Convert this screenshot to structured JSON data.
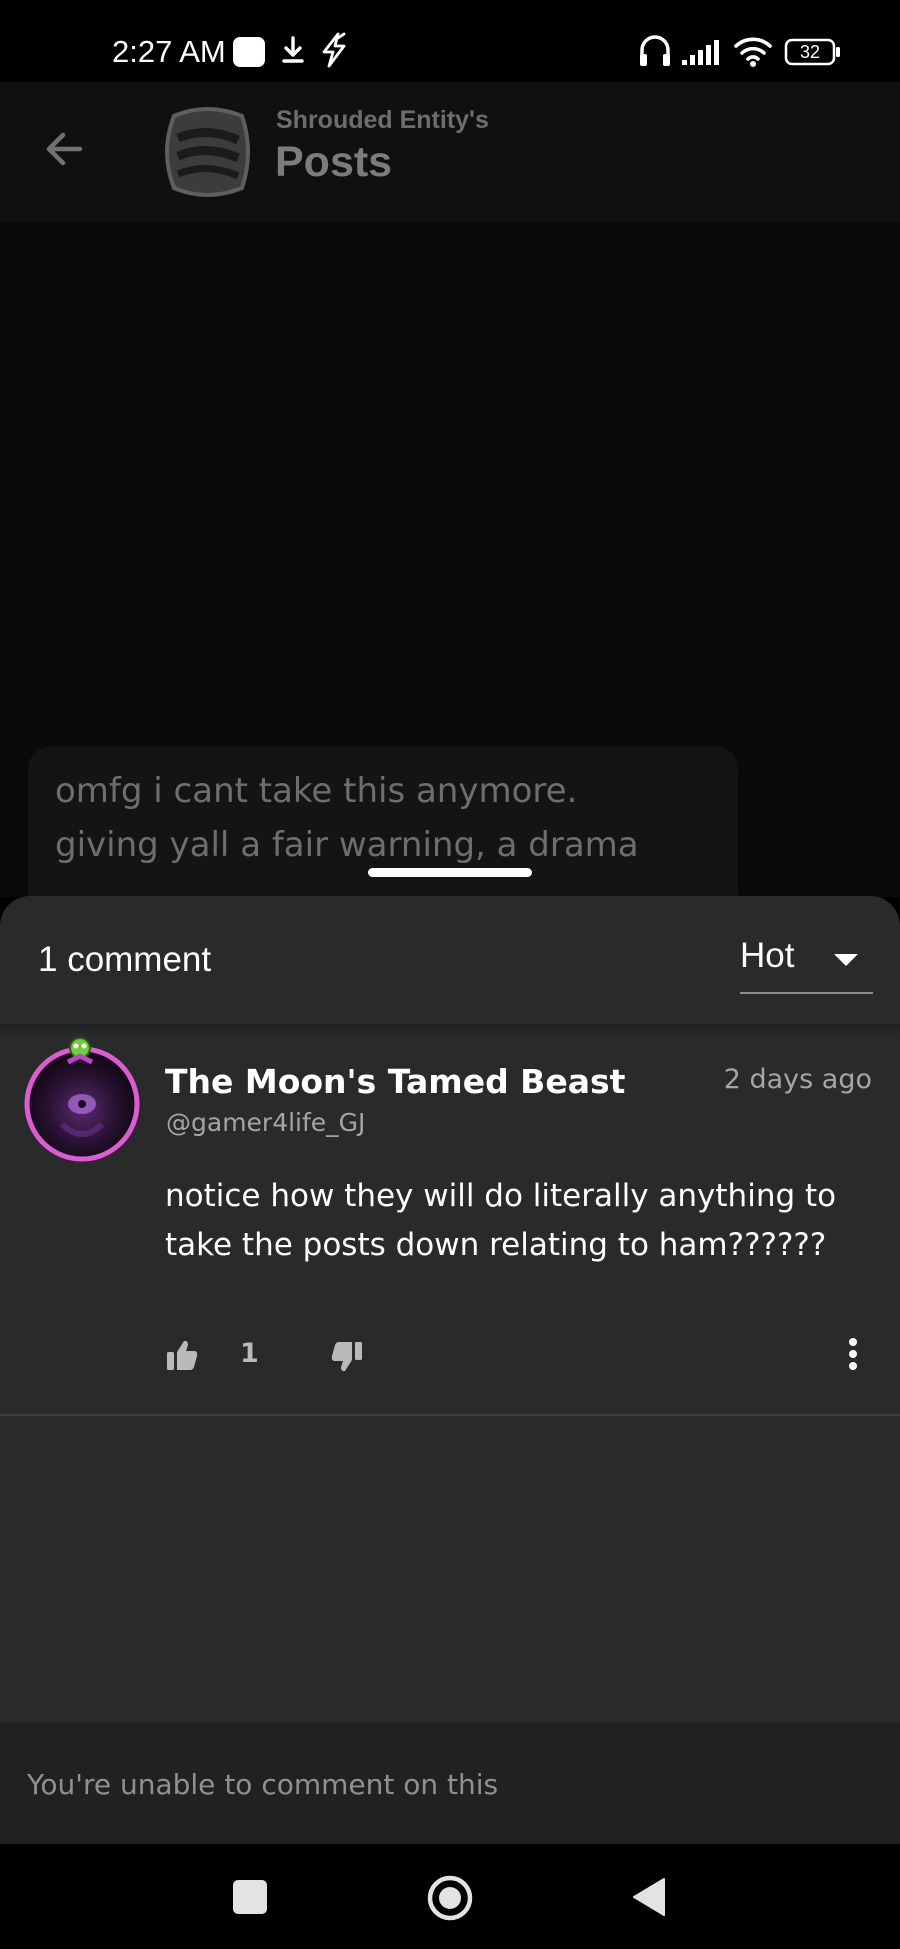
{
  "status_bar": {
    "time": "2:27 AM",
    "battery": "32",
    "icons": [
      "app-notification-icon",
      "download-icon",
      "flash-icon",
      "headphones-icon",
      "signal-icon",
      "wifi-icon",
      "battery-icon"
    ]
  },
  "header": {
    "subtitle": "Shrouded Entity's",
    "title": "Posts"
  },
  "post": {
    "line1": "omfg i cant take this anymore.",
    "line2": "giving yall a fair warning, a drama"
  },
  "comments_sheet": {
    "count_label": "1 comment",
    "sort": {
      "selected": "Hot"
    },
    "comments": [
      {
        "author": "The Moon's Tamed Beast",
        "handle": "@gamer4life_GJ",
        "time": "2 days ago",
        "body": "notice how they will do literally anything to take the posts down relating to ham??????",
        "likes": "1"
      }
    ],
    "disabled_message": "You're unable to comment on this"
  },
  "colors": {
    "sheet_bg": "#282b2a",
    "avatar_ring": "#e05ad6"
  }
}
